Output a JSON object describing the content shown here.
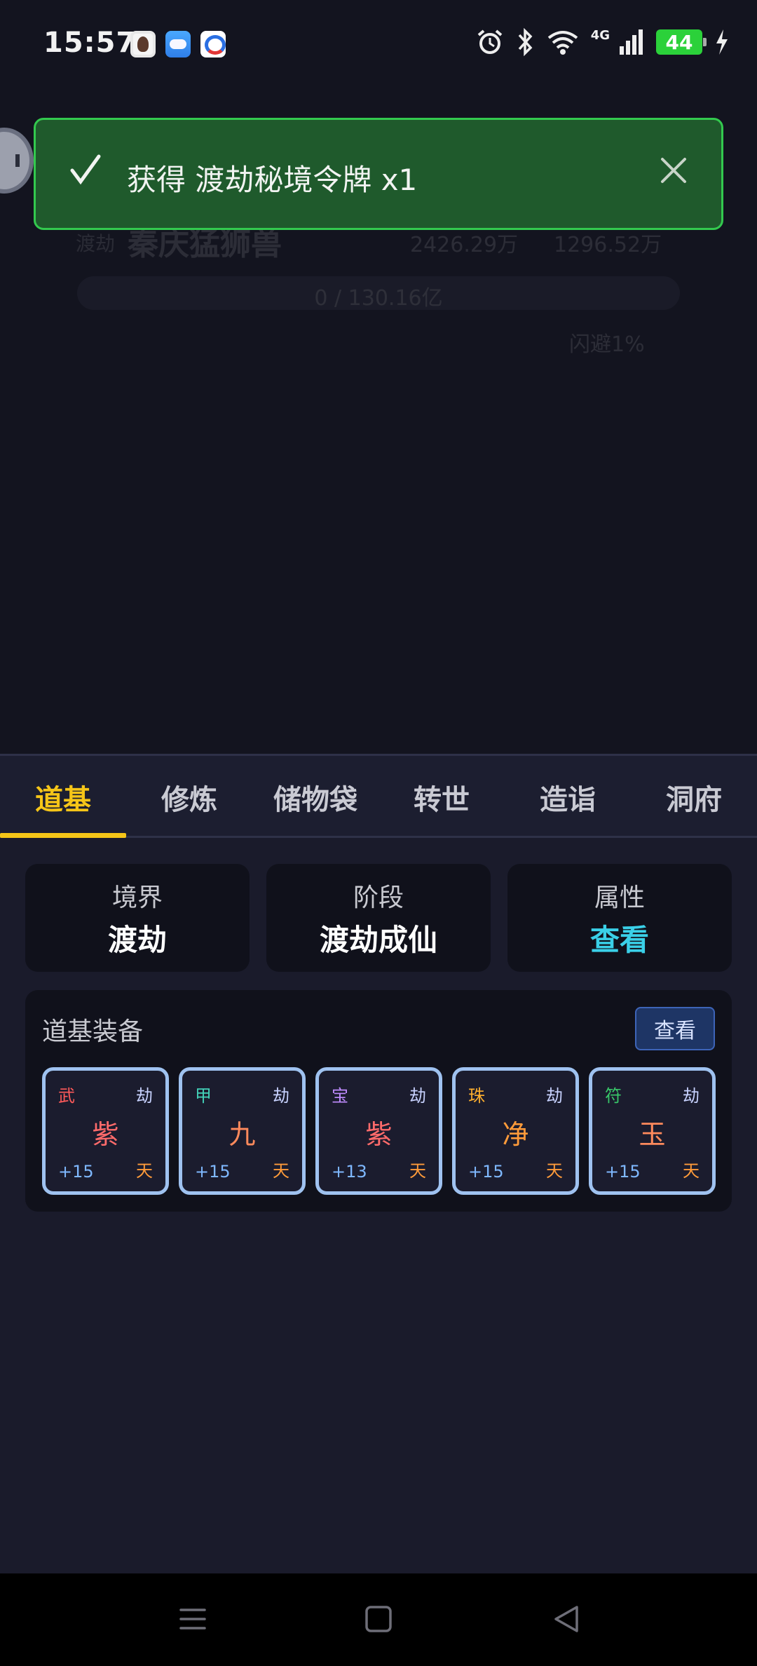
{
  "status_bar": {
    "time": "15:57",
    "network": "4G",
    "battery": "44"
  },
  "background": {
    "realm_short": "渡劫",
    "player_name": "秦庆猛狮兽",
    "stat_gold": "2426.29万",
    "stat_power": "1296.52万",
    "progress_text": "0 / 130.16亿",
    "dodge_text": "闪避1%"
  },
  "toast": {
    "message": "获得 渡劫秘境令牌 x1"
  },
  "tabs": [
    {
      "label": "道基",
      "active": true
    },
    {
      "label": "修炼"
    },
    {
      "label": "储物袋"
    },
    {
      "label": "转世"
    },
    {
      "label": "造诣"
    },
    {
      "label": "洞府"
    }
  ],
  "info_cards": [
    {
      "label": "境界",
      "value": "渡劫"
    },
    {
      "label": "阶段",
      "value": "渡劫成仙"
    },
    {
      "label": "属性",
      "value": "查看"
    }
  ],
  "equipment": {
    "title": "道基装备",
    "view_button": "查看",
    "items": [
      {
        "type": "武",
        "tier": "劫",
        "main": "紫",
        "level": "+15",
        "grade": "天",
        "type_color": "#ff5a5a",
        "main_color": "#ff6b6b"
      },
      {
        "type": "甲",
        "tier": "劫",
        "main": "九",
        "level": "+15",
        "grade": "天",
        "type_color": "#43d1b8",
        "main_color": "#ff8a5c"
      },
      {
        "type": "宝",
        "tier": "劫",
        "main": "紫",
        "level": "+13",
        "grade": "天",
        "type_color": "#c08cff",
        "main_color": "#ff6b6b"
      },
      {
        "type": "珠",
        "tier": "劫",
        "main": "净",
        "level": "+15",
        "grade": "天",
        "type_color": "#ffb02e",
        "main_color": "#ff9b3a"
      },
      {
        "type": "符",
        "tier": "劫",
        "main": "玉",
        "level": "+15",
        "grade": "天",
        "type_color": "#39c96a",
        "main_color": "#ff8a5c"
      }
    ]
  }
}
